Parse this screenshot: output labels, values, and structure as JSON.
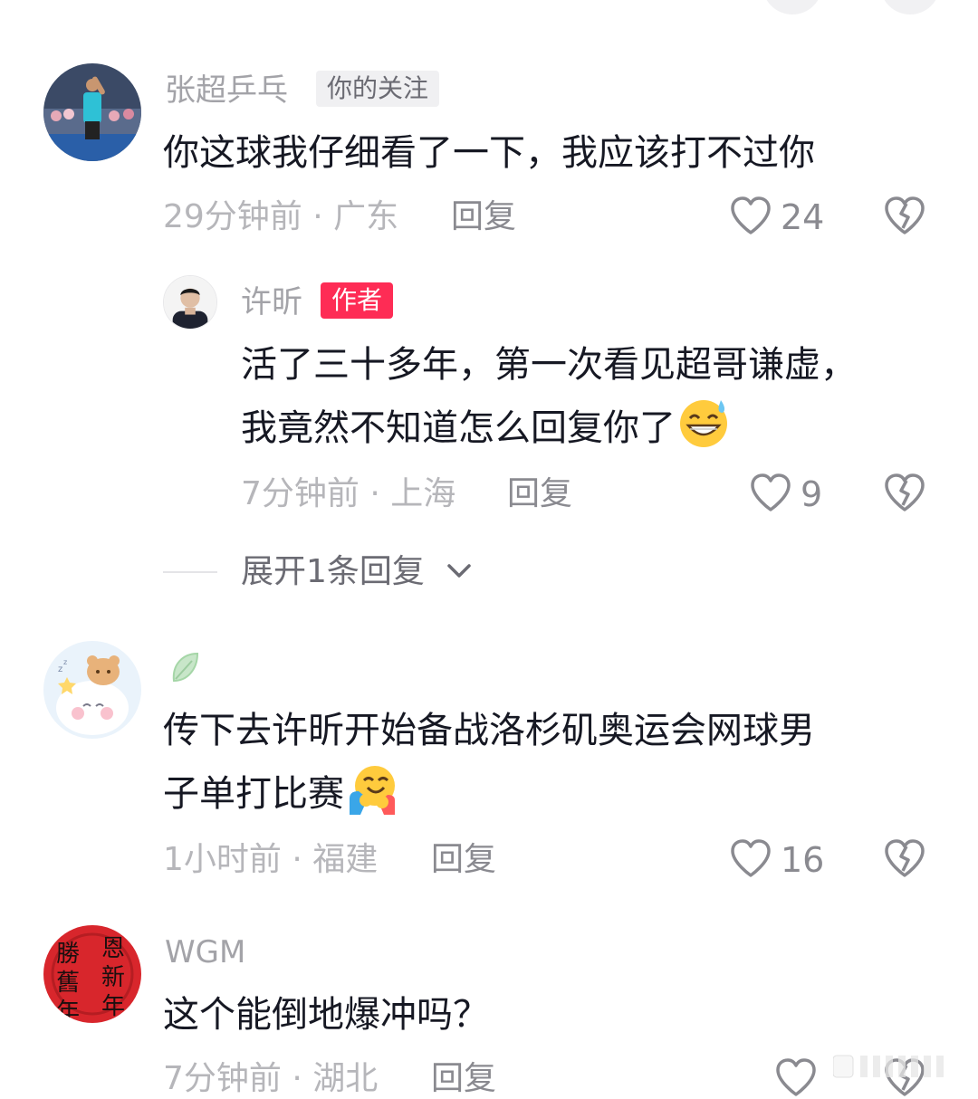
{
  "comments": [
    {
      "name": "张超乒乓",
      "badge": "你的关注",
      "text": "你这球我仔细看了一下，我应该打不过你",
      "meta": "29分钟前 · 广东",
      "reply": "回复",
      "likes": "24"
    },
    {
      "name": "",
      "text_line1": "传下去许昕开始备战洛杉矶奥运会网球男",
      "text_line2": "子单打比赛",
      "meta": "1小时前 · 福建",
      "reply": "回复",
      "likes": "16"
    },
    {
      "name": "WGM",
      "text": "这个能倒地爆冲吗？",
      "meta": "7分钟前 · 湖北",
      "reply": "回复"
    }
  ],
  "sub_reply": {
    "name": "许昕",
    "badge": "作者",
    "text_line1": "活了三十多年，第一次看见超哥谦虚，",
    "text_line2": "我竟然不知道怎么回复你了",
    "meta": "7分钟前 · 上海",
    "reply": "回复",
    "likes": "9"
  },
  "expand": {
    "label": "展开1条回复"
  },
  "avatar4_text": [
    "恩",
    "新",
    "勝",
    "舊",
    "年",
    "年"
  ],
  "colors": {
    "accent": "#fe2c55",
    "text": "#161823",
    "muted": "#a3a3a8"
  }
}
